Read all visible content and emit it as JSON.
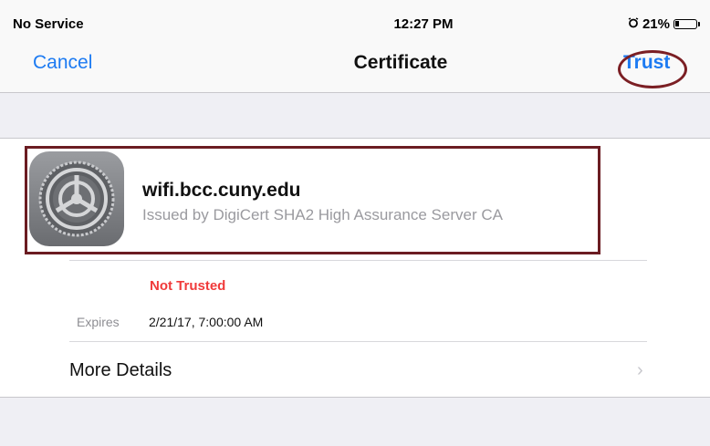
{
  "status_bar": {
    "carrier": "No Service",
    "time": "12:27 PM",
    "alarm_icon": "alarm-clock-icon",
    "battery_percent": "21%",
    "battery_level": 0.21
  },
  "nav": {
    "cancel_label": "Cancel",
    "title": "Certificate",
    "trust_label": "Trust"
  },
  "certificate": {
    "icon": "settings-gear-icon",
    "name": "wifi.bcc.cuny.edu",
    "issuer": "Issued by DigiCert SHA2 High Assurance Server CA",
    "status": "Not Trusted",
    "expires_label": "Expires",
    "expires_value": "2/21/17, 7:00:00 AM"
  },
  "more_details": {
    "label": "More Details",
    "chevron": "›"
  },
  "colors": {
    "accent": "#1d7bf2",
    "warning": "#f03a3a",
    "annotation": "#6b1c22"
  }
}
